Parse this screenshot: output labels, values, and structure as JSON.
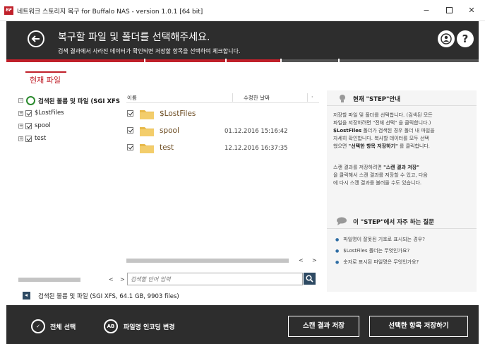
{
  "window": {
    "icon_text": "BF",
    "title": "네트워크 스토리지 복구 for Buffalo NAS - version 1.0.1 [64 bit]",
    "minimize": "−",
    "close": "✕"
  },
  "header": {
    "title": "복구할 파일 및 폴더를 선택해주세요.",
    "subtitle": "검색 결과에서 사라진 데이터가 확인되면 저장할 항목을 선택하여 체크합니다.",
    "question": "?"
  },
  "colors": {
    "accent": "#c0202a",
    "dark": "#2d2d2d",
    "navy": "#2e4a63",
    "folder": "#e8b94a"
  },
  "current_tab": "현재 파일",
  "tree": {
    "root": "검색된 볼륨 및 파일 (SGI XFS",
    "items": [
      {
        "label": "$LostFiles"
      },
      {
        "label": "spool"
      },
      {
        "label": "test"
      }
    ],
    "scroll_left": "<",
    "scroll_right": ">"
  },
  "list": {
    "col_name": "이름",
    "col_date": "수정한 날짜",
    "col_more": "·",
    "rows": [
      {
        "name": "$LostFiles",
        "date": ""
      },
      {
        "name": "spool",
        "date": "01.12.2016 15:16:42"
      },
      {
        "name": "test",
        "date": "12.12.2016 16:37:35"
      }
    ],
    "scroll_left": "<",
    "scroll_right": ">"
  },
  "search": {
    "placeholder": "검색할 단어 입력"
  },
  "help": {
    "step_title": "현재 \"STEP\"안내",
    "p1_a": "저장할 파일 및 폴더를 선택합니다. (검색된 모든",
    "p1_b": "파일을 저장하려면 \"전체 선택\" 을 클릭합니다.)",
    "p1_c_bold": "$LostFiles",
    "p1_c": " 폴더가 검색된 경우 폴더 내 파일을",
    "p1_d": "자세히 확인합니다. 복사할 데이터를 모두 선택",
    "p1_e": "했으면 ",
    "p1_e_bold": "\"선택한 항목 저장하기\"",
    "p1_e_tail": " 를 클릭합니다.",
    "p2_a": "스캔 결과를 저장하려면 ",
    "p2_a_bold": "\"스캔 결과 저장\"",
    "p2_b": "을 클릭해서 스캔 결과를 저장할 수 있고, 다음",
    "p2_c": "에 다시 스캔 결과를 불러올 수도 있습니다.",
    "faq_title": "이 \"STEP\"에서 자주 하는 질문",
    "faq": [
      "파일명이 잘못된 기호로 표시되는 경우?",
      "$LostFiles 폴더는 무엇인가요?",
      "숫자로 표시된 파일명은 무엇인가요?"
    ]
  },
  "status": "검색된 볼륨 및 파일 (SGI XFS, 64.1 GB, 9903 files)",
  "footer": {
    "select_all_icon": "✓",
    "select_all": "전체 선택",
    "encoding_icon": "AB",
    "encoding": "파일명 인코딩 변경",
    "save_scan": "스캔 결과 저장",
    "save_selected": "선택한 항목 저장하기"
  }
}
